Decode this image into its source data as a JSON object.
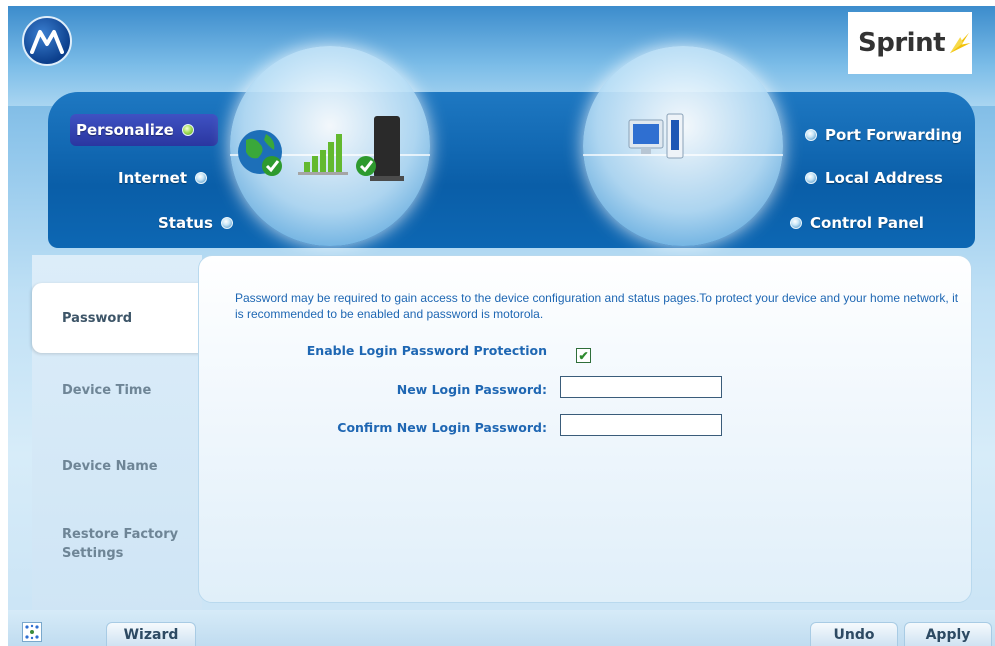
{
  "brand": {
    "logo_icon": "motorola-logo",
    "carrier_name": "Sprint",
    "carrier_icon": "sprint-wing-logo",
    "accent_color": "#0a5ea8",
    "text_blue": "#1f67b3"
  },
  "nav_left": {
    "items": [
      {
        "label": "Personalize",
        "active": true
      },
      {
        "label": "Internet",
        "active": false
      },
      {
        "label": "Status",
        "active": false
      }
    ]
  },
  "nav_right": {
    "items": [
      {
        "label": "Port Forwarding"
      },
      {
        "label": "Local Address"
      },
      {
        "label": "Control Panel"
      }
    ]
  },
  "illustrations": {
    "left_bubble_icons": [
      "globe-icon",
      "signal-bars-icon",
      "router-icon",
      "check-icon"
    ],
    "right_bubble_icons": [
      "computer-icon"
    ]
  },
  "sidebar": {
    "tabs": [
      {
        "label": "Password",
        "active": true
      },
      {
        "label": "Device Time",
        "active": false
      },
      {
        "label": "Device Name",
        "active": false
      },
      {
        "label": "Restore Factory Settings",
        "active": false
      }
    ]
  },
  "content": {
    "description": "Password may be required to gain access to the device configuration and status pages.To protect your device and your home network, it is recommended to be enabled and password is motorola.",
    "enable_label": "Enable Login Password Protection",
    "enable_checked": true,
    "new_password_label": "New Login Password:",
    "new_password_value": "",
    "confirm_password_label": "Confirm New Login Password:",
    "confirm_password_value": ""
  },
  "bottom_bar": {
    "sitemap_icon": "sitemap-icon",
    "wizard_label": "Wizard",
    "undo_label": "Undo",
    "apply_label": "Apply"
  }
}
